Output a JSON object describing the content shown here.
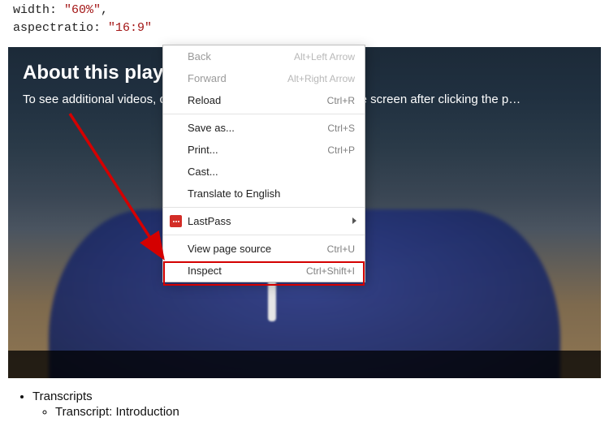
{
  "code": {
    "line1_key": "width:",
    "line1_val": "\"60%\"",
    "line1_tail": ",",
    "line2_key": "aspectratio:",
    "line2_val": "\"16:9\""
  },
  "overlay": {
    "title": "About this playlist",
    "subtitle": "To see additional videos, click the icon (≡) on the top-right of the screen after clicking the p…"
  },
  "menu": {
    "back": {
      "label": "Back",
      "shortcut": "Alt+Left Arrow"
    },
    "forward": {
      "label": "Forward",
      "shortcut": "Alt+Right Arrow"
    },
    "reload": {
      "label": "Reload",
      "shortcut": "Ctrl+R"
    },
    "saveas": {
      "label": "Save as...",
      "shortcut": "Ctrl+S"
    },
    "print": {
      "label": "Print...",
      "shortcut": "Ctrl+P"
    },
    "cast": {
      "label": "Cast..."
    },
    "translate": {
      "label": "Translate to English"
    },
    "lastpass": {
      "label": "LastPass"
    },
    "viewsource": {
      "label": "View page source",
      "shortcut": "Ctrl+U"
    },
    "inspect": {
      "label": "Inspect",
      "shortcut": "Ctrl+Shift+I"
    }
  },
  "transcripts": {
    "heading": "Transcripts",
    "item1": "Transcript: Introduction"
  }
}
